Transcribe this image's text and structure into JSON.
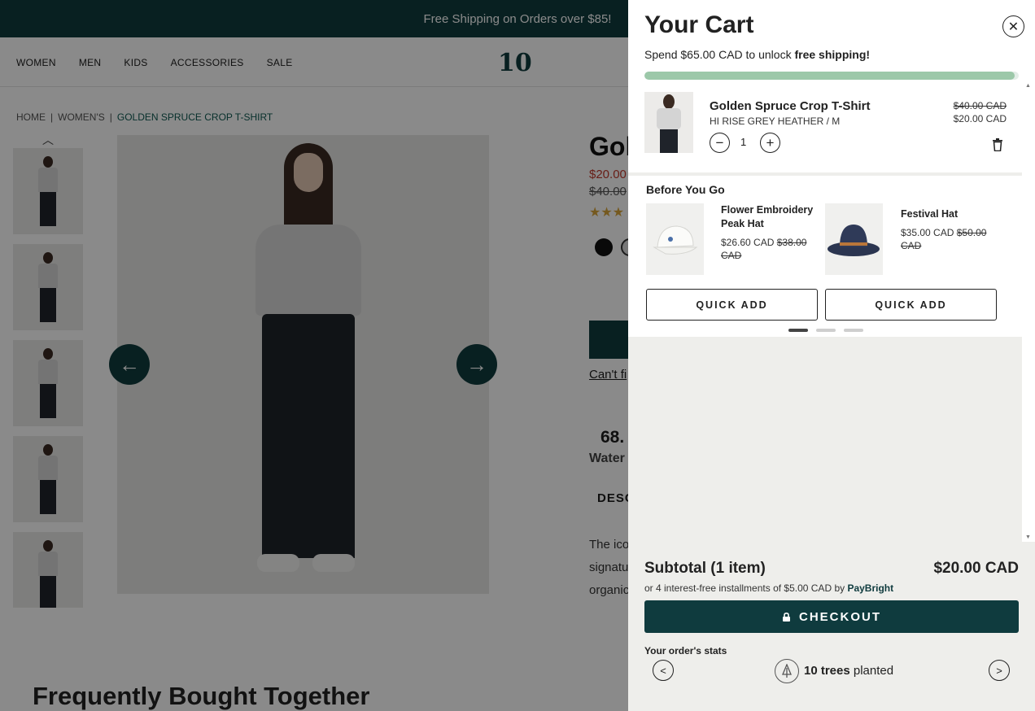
{
  "store": {
    "announcement": "Free Shipping on Orders over $85!",
    "nav": [
      "WOMEN",
      "MEN",
      "KIDS",
      "ACCESSORIES",
      "SALE"
    ],
    "logo_text": "10",
    "breadcrumb": [
      "HOME",
      "WOMEN'S",
      "GOLDEN SPRUCE CROP T-SHIRT"
    ],
    "breadcrumb_sep": "|",
    "product_title_partial": "Gol",
    "price": "$20.00",
    "old_price": "$40.00",
    "stars": "★★★",
    "size_help_partial": "Can't fi",
    "stat_partial": "68.",
    "stat_label_partial": "Water",
    "desc_tab_partial": "DESC",
    "desc_lines": [
      "The ico",
      "signatu",
      "organic"
    ],
    "fbt_title": "Frequently Bought Together",
    "arrow_left": "←",
    "arrow_right": "→",
    "thumb_up": "︿"
  },
  "cart": {
    "title": "Your Cart",
    "close_glyph": "✕",
    "shipping_prefix": "Spend $65.00 CAD to unlock ",
    "shipping_emphasis": "free shipping!",
    "shipping_progress": 0.99,
    "item": {
      "name": "Golden Spruce Crop T-Shirt",
      "variant": "HI RISE GREY HEATHER / M",
      "quantity": "1",
      "minus": "−",
      "plus": "+",
      "compare_price": "$40.00 CAD",
      "price": "$20.00 CAD"
    },
    "upsell": {
      "title": "Before You Go",
      "products": [
        {
          "name": "Flower Embroidery Peak Hat",
          "price": "$26.60 CAD",
          "compare": "$38.00 CAD",
          "button": "QUICK ADD"
        },
        {
          "name": "Festival Hat",
          "price": "$35.00 CAD",
          "compare": "$50.00 CAD",
          "button": "QUICK ADD"
        }
      ]
    },
    "subtotal_label": "Subtotal (1 item)",
    "subtotal_value": "$20.00 CAD",
    "installments_prefix": "or 4 interest-free installments of $5.00 CAD by ",
    "installments_brand": "PayBright",
    "checkout_label": "CHECKOUT",
    "stats_label": "Your order's stats",
    "trees_count": "10 trees",
    "trees_suffix": " planted",
    "prev_glyph": "<",
    "next_glyph": ">"
  },
  "colors": {
    "brand": "#0f3b3e",
    "progress": "#9cc8a9",
    "sale": "#c0392b"
  }
}
